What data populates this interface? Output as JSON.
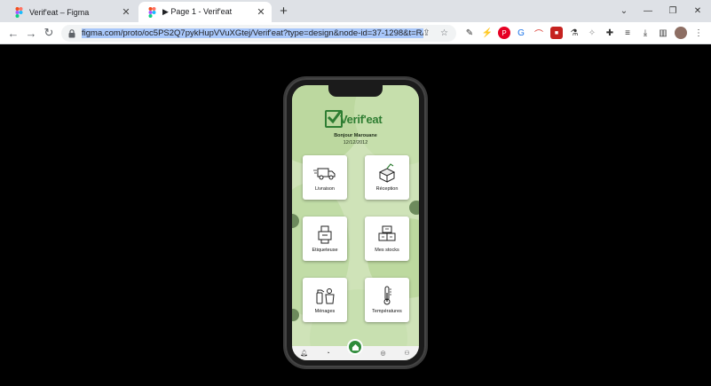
{
  "browser": {
    "tabs": [
      {
        "title": "Verif'eat – Figma",
        "active": false
      },
      {
        "title": "▶ Page 1 - Verif'eat",
        "active": true
      }
    ],
    "url": "figma.com/proto/oc5PS2Q7pykHupVVuXGtej/Verif'eat?type=design&node-id=37-1298&t=RA3V8"
  },
  "app": {
    "brand": "Verif'eat",
    "greeting": "Bonjour Marouane",
    "date": "12/12/2012",
    "tiles": [
      {
        "label": "Livraison",
        "icon": "delivery-truck-icon"
      },
      {
        "label": "Réception",
        "icon": "open-box-icon"
      },
      {
        "label": "Etiqueteuse",
        "icon": "label-printer-icon"
      },
      {
        "label": "Mes stocks",
        "icon": "stock-boxes-icon"
      },
      {
        "label": "Ménages",
        "icon": "cleaning-spray-icon"
      },
      {
        "label": "Températures",
        "icon": "thermometer-icon"
      }
    ],
    "colors": {
      "brand_green": "#2e7d32",
      "background": "#cfe3b8"
    }
  }
}
